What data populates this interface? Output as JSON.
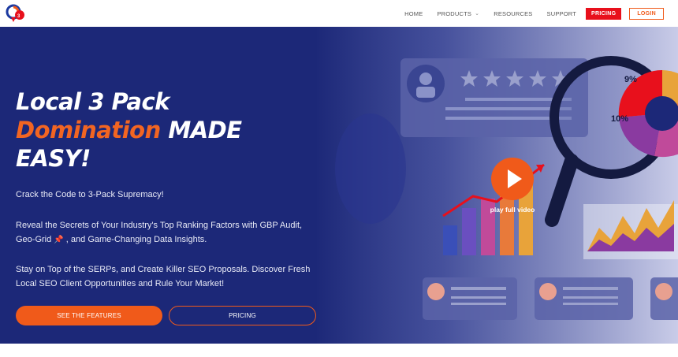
{
  "nav": {
    "links": [
      "HOME",
      "PRODUCTS",
      "RESOURCES",
      "SUPPORT"
    ],
    "pricing_button": "PRICING",
    "login_button": "LOGIN"
  },
  "hero": {
    "headline": {
      "line1": "Local 3 Pack",
      "accent": "Domination",
      "line2_rest": " MADE",
      "line3": "EASY!"
    },
    "paragraph1": "Crack the Code to 3-Pack Supremacy!",
    "paragraph2_part1": "Reveal the Secrets of Your Industry's Top Ranking Factors with GBP Audit,",
    "paragraph2_part2a": "Geo-Grid ",
    "paragraph2_part2b": " , and Game-Changing Data Insights.",
    "paragraph3_line1": "Stay on Top of the SERPs, and Create Killer SEO Proposals. Discover Fresh",
    "paragraph3_line2": "Local SEO Client Opportunities and Rule Your Market!",
    "cta_features": "SEE THE FEATURES",
    "cta_pricing": "PRICING",
    "play_label": "play full video",
    "chart_percent_1": "9%",
    "chart_percent_2": "10%"
  },
  "colors": {
    "hero_bg": "#1c2878",
    "accent_orange": "#f05a1a",
    "pricing_red": "#e8101c"
  }
}
